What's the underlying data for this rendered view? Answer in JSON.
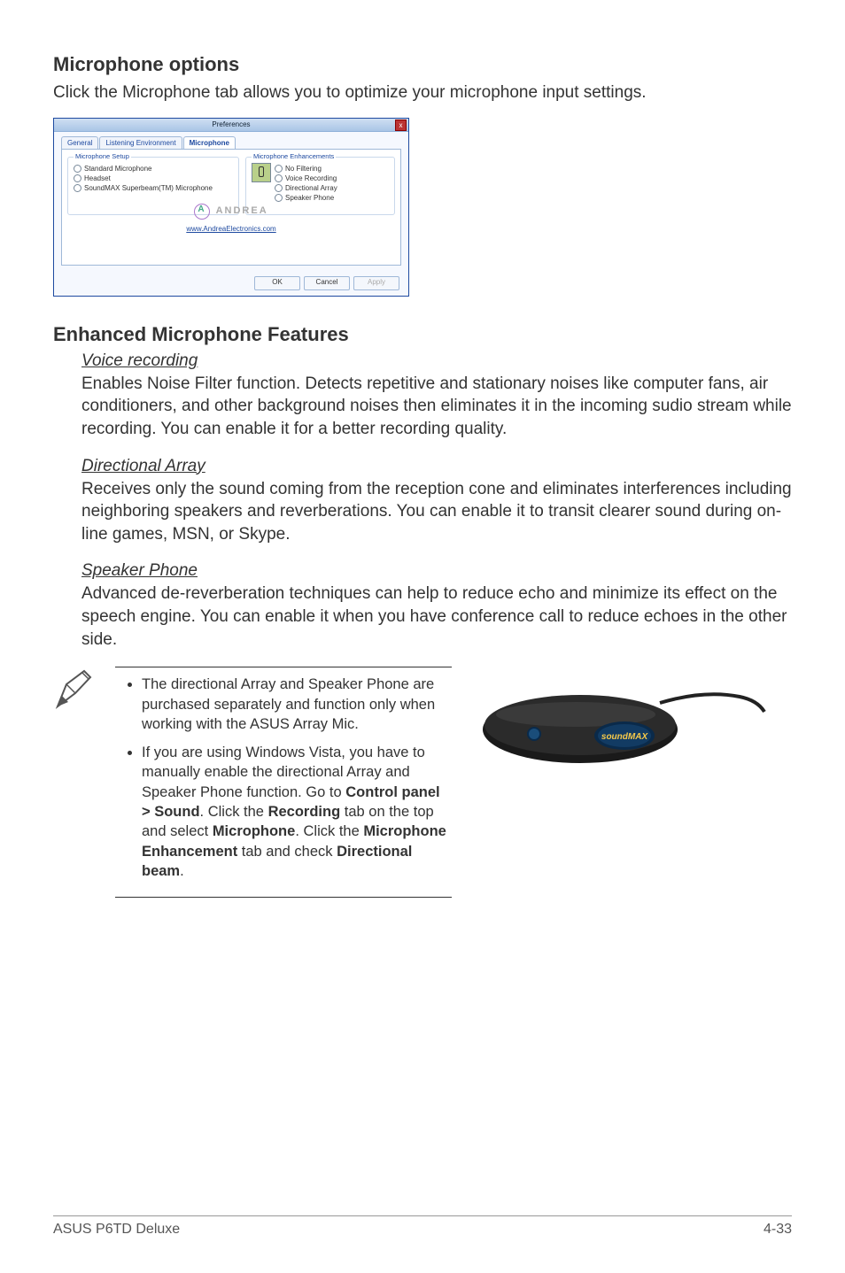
{
  "section1": {
    "heading": "Microphone options",
    "intro": "Click the Microphone tab allows you to optimize your microphone input settings."
  },
  "screenshot": {
    "title": "Preferences",
    "close": "x",
    "tabs": {
      "general": "General",
      "listening": "Listening Environment",
      "microphone": "Microphone"
    },
    "setup_legend": "Microphone Setup",
    "setup_options": {
      "standard": "Standard Microphone",
      "headset": "Headset",
      "superbeam": "SoundMAX Superbeam(TM) Microphone"
    },
    "enh_legend": "Microphone Enhancements",
    "enh_options": {
      "nofilter": "No Filtering",
      "voice": "Voice Recording",
      "directional": "Directional Array",
      "speaker": "Speaker Phone"
    },
    "logo": "ANDREA",
    "link": "www.AndreaElectronics.com",
    "ok": "OK",
    "cancel": "Cancel",
    "apply": "Apply"
  },
  "section2": {
    "heading": "Enhanced Microphone Features",
    "voice": {
      "title": "Voice recording",
      "body": "Enables Noise Filter function. Detects repetitive and stationary noises like computer fans, air conditioners, and other background noises then eliminates it in the incoming sudio stream while recording. You can enable it for a better recording quality."
    },
    "directional": {
      "title": "Directional Array",
      "body": "Receives only the sound coming from the reception cone and eliminates interferences including neighboring speakers and reverberations. You can enable it to transit clearer sound during on-line games, MSN, or Skype."
    },
    "speaker": {
      "title": "Speaker Phone",
      "body": "Advanced de-reverberation techniques can help to reduce echo and minimize its effect on the speech engine. You can enable it when you have conference call to reduce echoes in the other side."
    }
  },
  "notes": {
    "item1": "The directional Array and Speaker Phone are purchased separately and function only when working with the ASUS Array Mic.",
    "item2_pre": "If you are using Windows Vista, you have to manually enable the directional Array and Speaker Phone function. Go to ",
    "item2_bold1": "Control panel > Sound",
    "item2_mid1": ". Click the ",
    "item2_bold2": "Recording",
    "item2_mid2": " tab on the top and select ",
    "item2_bold3": "Microphone",
    "item2_mid3": ". Click the ",
    "item2_bold4": "Microphone Enhancement",
    "item2_mid4": " tab and check ",
    "item2_bold5": "Directional beam",
    "item2_end": "."
  },
  "footer": {
    "left": "ASUS P6TD Deluxe",
    "right": "4-33"
  }
}
